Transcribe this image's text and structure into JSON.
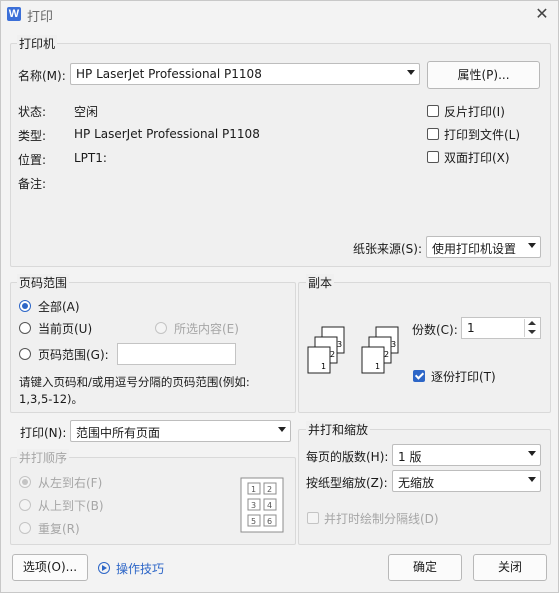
{
  "window": {
    "title": "打印",
    "app_icon": "W"
  },
  "printer": {
    "group_title": "打印机",
    "name_label": "名称(M):",
    "name_value": "HP LaserJet Professional P1108",
    "properties_button": "属性(P)...",
    "status_label": "状态:",
    "status_value": "空闲",
    "type_label": "类型:",
    "type_value": "HP LaserJet Professional P1108",
    "location_label": "位置:",
    "location_value": "LPT1:",
    "comment_label": "备注:",
    "reverse_print": {
      "label": "反片打印(I)",
      "checked": false
    },
    "print_to_file": {
      "label": "打印到文件(L)",
      "checked": false
    },
    "duplex": {
      "label": "双面打印(X)",
      "checked": false
    },
    "paper_source_label": "纸张来源(S):",
    "paper_source_value": "使用打印机设置"
  },
  "page_range": {
    "group_title": "页码范围",
    "all": {
      "label": "全部(A)",
      "checked": true
    },
    "current": {
      "label": "当前页(U)",
      "checked": false
    },
    "selection": {
      "label": "所选内容(E)",
      "checked": false,
      "disabled": true
    },
    "pages": {
      "label": "页码范围(G):",
      "checked": false,
      "value": ""
    },
    "hint_line1": "请键入页码和/或用逗号分隔的页码范围(例如:",
    "hint_line2": "1,3,5-12)。"
  },
  "copies": {
    "group_title": "副本",
    "count_label": "份数(C):",
    "count_value": "1",
    "collate": {
      "label": "逐份打印(T)",
      "checked": true
    },
    "icon_labels": [
      "1",
      "2",
      "3"
    ]
  },
  "print_what": {
    "label": "打印(N):",
    "value": "范围中所有页面"
  },
  "pages_order": {
    "group_title": "并打顺序",
    "left_to_right": {
      "label": "从左到右(F)",
      "checked": true
    },
    "top_to_bottom": {
      "label": "从上到下(B)",
      "checked": false
    },
    "repeat": {
      "label": "重复(R)",
      "checked": false
    },
    "preview_numbers": [
      "1",
      "2",
      "3",
      "4",
      "5",
      "6"
    ]
  },
  "zoom": {
    "group_title": "并打和缩放",
    "pages_per_sheet_label": "每页的版数(H):",
    "pages_per_sheet_value": "1 版",
    "scale_label": "按纸型缩放(Z):",
    "scale_value": "无缩放",
    "draw_separator": {
      "label": "并打时绘制分隔线(D)",
      "checked": false
    }
  },
  "footer": {
    "options_button": "选项(O)...",
    "tips_link": "操作技巧",
    "ok_button": "确定",
    "close_button": "关闭"
  },
  "colors": {
    "accent": "#2d66c7",
    "dialog_bg": "#f0f0f0",
    "app_icon_bg": "#3b6fd8"
  }
}
